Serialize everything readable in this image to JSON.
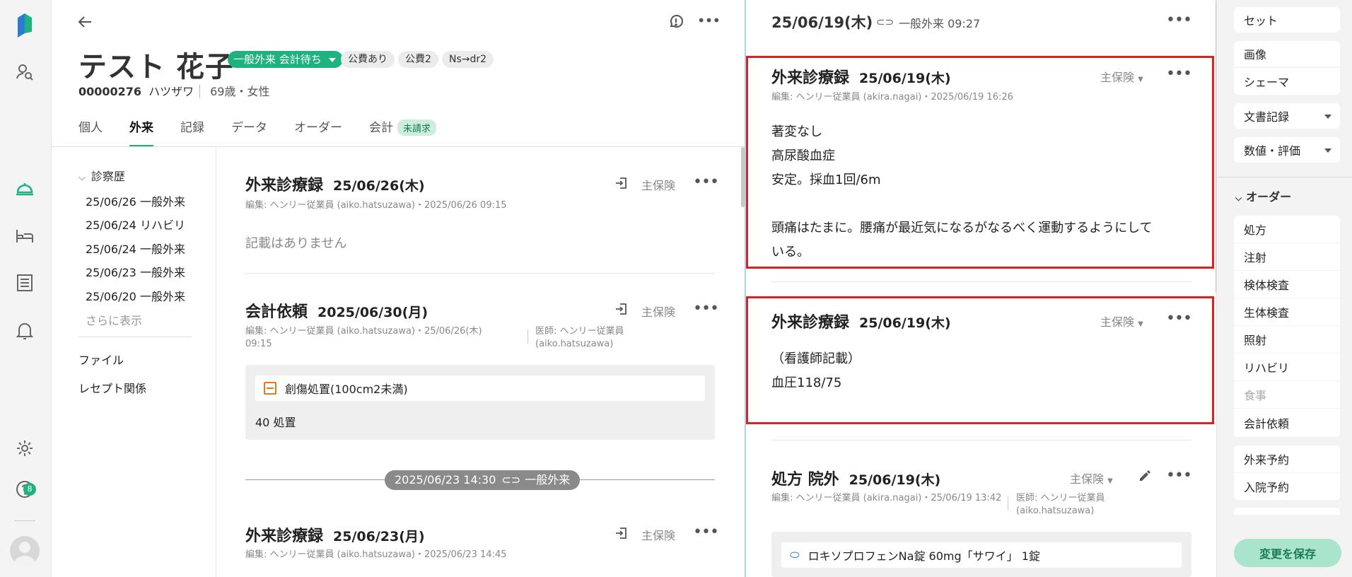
{
  "nav": {
    "notification_count": "8"
  },
  "patient": {
    "name": "テスト 花子",
    "status": "一般外来 会計待ち",
    "tags": [
      "公費あり",
      "公費2",
      "Ns→dr2"
    ],
    "id": "00000276",
    "kana": "ハツザワ",
    "age_sex": "69歳・女性"
  },
  "tabs": [
    {
      "label": "個人"
    },
    {
      "label": "外来"
    },
    {
      "label": "記録"
    },
    {
      "label": "データ"
    },
    {
      "label": "オーダー"
    },
    {
      "label": "会計",
      "badge": "未請求"
    }
  ],
  "history": {
    "heading": "診察歴",
    "items": [
      "25/06/26 一般外来",
      "25/06/24 リハビリ",
      "25/06/24 一般外来",
      "25/06/23 一般外来",
      "25/06/20 一般外来"
    ],
    "more": "さらに表示",
    "links": [
      "ファイル",
      "レセプト関係"
    ]
  },
  "records": {
    "r1": {
      "title": "外来診療録",
      "date": "25/06/26(木)",
      "insurance": "主保険",
      "meta": "編集: ヘンリー従業員 (aiko.hatsuzawa)・2025/06/26 09:15",
      "empty": "記載はありません"
    },
    "r2": {
      "title": "会計依頼",
      "date": "2025/06/30(月)",
      "insurance": "主保険",
      "meta_edit": "編集: ヘンリー従業員 (aiko.hatsuzawa)・25/06/26(木) 09:15",
      "meta_doctor": "医師: ヘンリー従業員 (aiko.hatsuzawa)",
      "item": "創傷処置(100cm2未満)",
      "points": "40 処置"
    },
    "separator": {
      "datetime": "2025/06/23 14:30",
      "type": "一般外来"
    },
    "r3": {
      "title": "外来診療録",
      "date": "25/06/23(月)",
      "insurance": "主保険",
      "meta": "編集: ヘンリー従業員 (aiko.hatsuzawa)・2025/06/23 14:45"
    }
  },
  "encounter": {
    "date": "25/06/19(木)",
    "type_time": "一般外来 09:27",
    "e1": {
      "title": "外来診療録",
      "date": "25/06/19(木)",
      "insurance": "主保険",
      "meta": "編集: ヘンリー従業員 (akira.nagai)・2025/06/19 16:26",
      "lines": [
        "著変なし",
        "高尿酸血症",
        "安定。採血1回/6m",
        "",
        "頭痛はたまに。腰痛が最近気になるがなるべく運動するようにして",
        "いる。"
      ]
    },
    "e2": {
      "title": "外来診療録",
      "date": "25/06/19(木)",
      "insurance": "主保険",
      "lines": [
        "（看護師記載）",
        "血圧118/75"
      ]
    },
    "e3": {
      "title": "処方 院外",
      "date": "25/06/19(木)",
      "insurance": "主保険",
      "meta_edit": "編集: ヘンリー従業員 (akira.nagai)・25/06/19 13:42",
      "meta_doctor": "医師: ヘンリー従業員 (aiko.hatsuzawa)",
      "drug": "ロキソプロフェンNa錠 60mg「サワイ」 1錠"
    }
  },
  "side": {
    "top": [
      "セット",
      "画像",
      "シェーマ",
      "文書記録",
      "数値・評価"
    ],
    "order_heading": "オーダー",
    "orders": [
      "処方",
      "注射",
      "検体検査",
      "生体検査",
      "照射",
      "リハビリ",
      "食事",
      "会計依頼"
    ],
    "reservations": [
      "外来予約",
      "入院予約"
    ],
    "save": "変更を保存"
  },
  "colors": {
    "accent": "#1db27e",
    "highlight": "#e02020"
  }
}
